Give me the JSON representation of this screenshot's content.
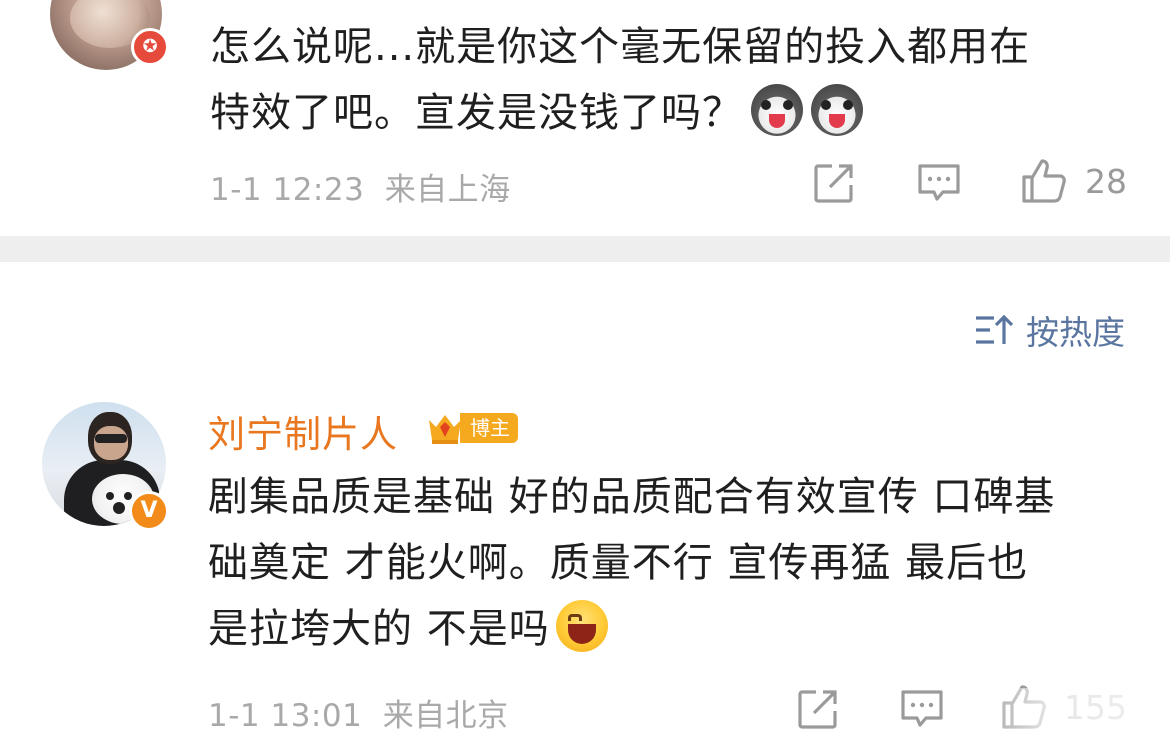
{
  "comment1": {
    "text_line1": "怎么说呢...就是你这个毫无保留的投入都用在",
    "text_line2": "特效了吧。宣发是没钱了吗？",
    "emoji": "husky-emoji",
    "time": "1-1 12:23",
    "location": "来自上海",
    "likes": "28"
  },
  "sort": {
    "label": "按热度",
    "icon": "sort-icon"
  },
  "comment2": {
    "author": "刘宁制片人",
    "badge": "博主",
    "text_line1": "剧集品质是基础 好的品质配合有效宣传 口碑基",
    "text_line2": "础奠定 才能火啊。质量不行 宣传再猛 最后也",
    "text_line3": "是拉垮大的 不是吗",
    "emoji": "laugh-emoji",
    "time": "1-1 13:01",
    "location": "来自北京",
    "likes": "155"
  },
  "colors": {
    "author": "#e8771f",
    "meta": "#a9a9a9",
    "link": "#5a76a0",
    "divider": "#eeeeee"
  }
}
